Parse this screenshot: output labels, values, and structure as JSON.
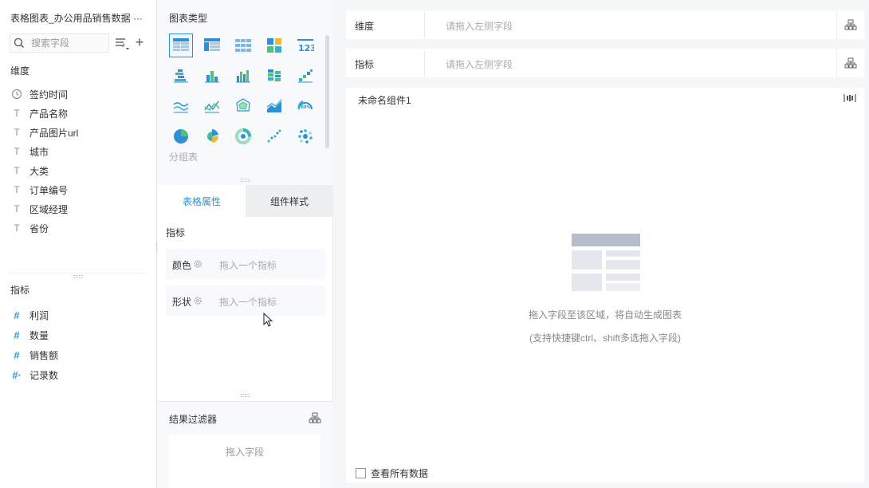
{
  "left": {
    "title": "表格图表_办公用品销售数据 ···",
    "search_placeholder": "搜索字段",
    "dimension_header": "维度",
    "dimensions": [
      {
        "label": "签约时间",
        "icon": "clock-icon"
      },
      {
        "label": "产品名称",
        "icon": "text-type-icon"
      },
      {
        "label": "产品图片url",
        "icon": "text-type-icon"
      },
      {
        "label": "城市",
        "icon": "text-type-icon"
      },
      {
        "label": "大类",
        "icon": "text-type-icon"
      },
      {
        "label": "订单编号",
        "icon": "text-type-icon"
      },
      {
        "label": "区域经理",
        "icon": "text-type-icon"
      },
      {
        "label": "省份",
        "icon": "text-type-icon"
      }
    ],
    "metric_header": "指标",
    "metrics": [
      {
        "label": "利润",
        "glyph": "#"
      },
      {
        "label": "数量",
        "glyph": "#"
      },
      {
        "label": "销售额",
        "glyph": "#"
      },
      {
        "label": "记录数",
        "glyph": "#·"
      }
    ]
  },
  "middle": {
    "chart_types_title": "图表类型",
    "group_table_label": "分组表",
    "tabs": [
      {
        "label": "表格属性",
        "active": true
      },
      {
        "label": "组件样式",
        "active": false
      }
    ],
    "attr_header": "指标",
    "attrs": [
      {
        "label": "颜色",
        "placeholder": "拖入一个指标"
      },
      {
        "label": "形状",
        "placeholder": "拖入一个指标"
      }
    ],
    "filter_title": "结果过滤器",
    "filter_placeholder": "拖入字段"
  },
  "right": {
    "dimension_label": "维度",
    "dimension_placeholder": "请拖入左侧字段",
    "metric_label": "指标",
    "metric_placeholder": "请拖入左侧字段",
    "widget_title": "未命名组件1",
    "hint_line1": "拖入字段至该区域，将自动生成图表",
    "hint_line2": "(支持快捷键ctrl、shift多选拖入字段)",
    "show_all_label": "查看所有数据"
  },
  "colors": {
    "accent": "#2f8fd6",
    "chart_teal": "#2fb5c8",
    "chart_green": "#4cc37c",
    "chart_yellow": "#f5b72f"
  }
}
